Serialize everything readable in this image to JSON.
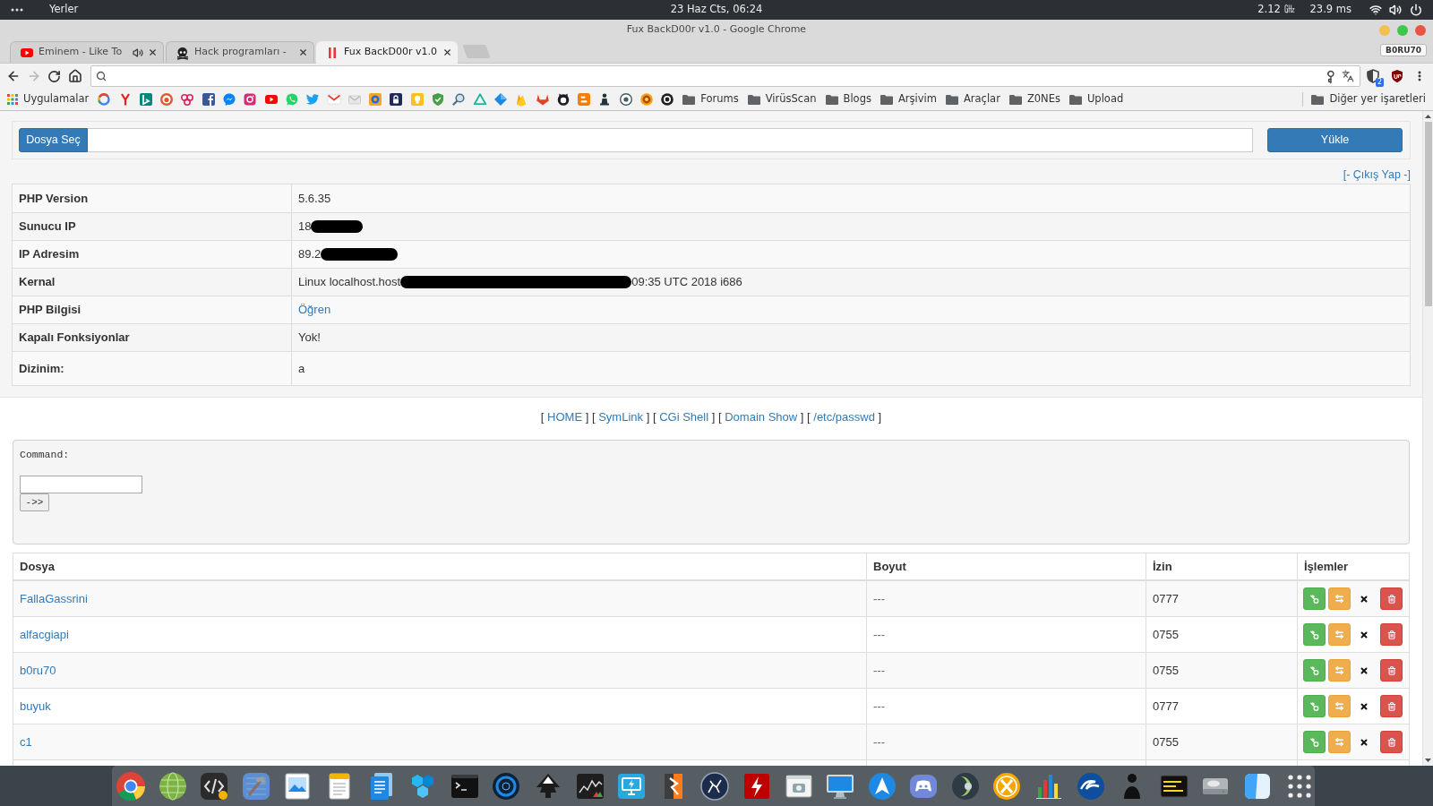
{
  "top_bar": {
    "places": "Yerler",
    "clock": "23 Haz Cts, 06:24",
    "cpu": "2.12 ㎓",
    "ping": "23.9 ms"
  },
  "window": {
    "title": "Fux BackD00r v1.0 - Google Chrome"
  },
  "tabs": [
    {
      "label": "Eminem - Like To",
      "selected": false,
      "audio": true
    },
    {
      "label": "Hack programları -",
      "selected": false,
      "audio": false
    },
    {
      "label": "Fux BackD00r v1.0",
      "selected": true,
      "audio": false
    }
  ],
  "profile": {
    "label": "B0RU70"
  },
  "toolbar": {
    "forward_disabled": true,
    "extension_badge": "2"
  },
  "bookmarks": {
    "apps": "Uygulamalar",
    "folders": [
      "Forums",
      "VirüsScan",
      "Blogs",
      "Arşivim",
      "Araçlar",
      "Z0NEs",
      "Upload"
    ],
    "other": "Diğer yer işaretleri"
  },
  "upload": {
    "choose_button": "Dosya Seç",
    "submit_button": "Yükle"
  },
  "logout_link": "[- Çıkış Yap -]",
  "info_table": [
    {
      "label": "PHP Version",
      "value": "5.6.35",
      "kind": "text",
      "redacted": false
    },
    {
      "label": "Sunucu IP",
      "value": "18",
      "kind": "text",
      "redacted": true
    },
    {
      "label": "IP Adresim",
      "value": "89.2",
      "kind": "text",
      "redacted": true
    },
    {
      "label": "Kernal",
      "value": "Linux localhost.host",
      "kind": "text",
      "redacted": true,
      "value_after": "09:35 UTC 2018 i686"
    },
    {
      "label": "PHP Bilgisi",
      "value": "Öğren",
      "kind": "link",
      "redacted": false
    },
    {
      "label": "Kapalı Fonksiyonlar",
      "value": "Yok!",
      "kind": "text",
      "redacted": false
    },
    {
      "label": "Dizinim:",
      "value": "a",
      "kind": "text",
      "redacted": false
    }
  ],
  "nav_links": [
    {
      "before": "[",
      "label": "HOME",
      "after": "]"
    },
    {
      "before": "[",
      "label": "SymLink",
      "after": "]"
    },
    {
      "before": "[",
      "label": "CGi Shell",
      "after": "]"
    },
    {
      "before": "[",
      "label": "Domain Show",
      "after": "]"
    },
    {
      "before": "[",
      "label": "/etc/passwd",
      "after": "]"
    }
  ],
  "command": {
    "label": "Command:",
    "button": "->>"
  },
  "files": {
    "columns": [
      "Dosya",
      "Boyut",
      "İzin",
      "İşlemler"
    ],
    "rows": [
      {
        "name": "FallaGassrini",
        "size": "---",
        "perms": "0777"
      },
      {
        "name": "alfacgiapi",
        "size": "---",
        "perms": "0755"
      },
      {
        "name": "b0ru70",
        "size": "---",
        "perms": "0755"
      },
      {
        "name": "buyuk",
        "size": "---",
        "perms": "0777"
      },
      {
        "name": "c1",
        "size": "---",
        "perms": "0755"
      }
    ]
  }
}
